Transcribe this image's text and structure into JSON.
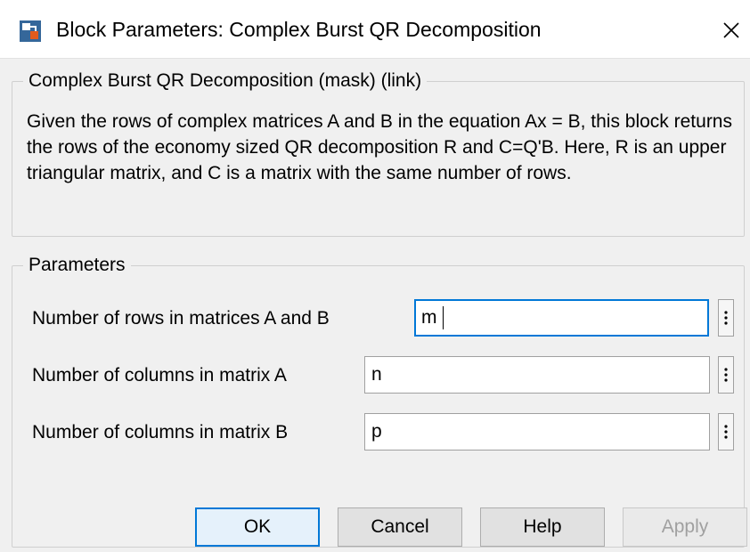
{
  "window": {
    "title": "Block Parameters: Complex Burst QR Decomposition",
    "close_icon": "close-icon",
    "app_icon": "simulink-block-icon"
  },
  "description_group": {
    "legend": "Complex Burst QR Decomposition (mask) (link)",
    "text": "Given the rows of complex matrices A and B in the equation Ax = B, this block returns the rows of the economy sized QR decomposition R and C=Q'B. Here, R is an upper triangular matrix, and C is a matrix with the same number of rows."
  },
  "parameters_group": {
    "legend": "Parameters",
    "fields": [
      {
        "label": "Number of rows in matrices A and B",
        "value": "m"
      },
      {
        "label": "Number of columns in matrix A",
        "value": "n"
      },
      {
        "label": "Number of columns in matrix B",
        "value": "p"
      }
    ],
    "field_menu_icon": "vertical-ellipsis-icon"
  },
  "buttons": {
    "ok": "OK",
    "cancel": "Cancel",
    "help": "Help",
    "apply": "Apply"
  },
  "colors": {
    "accent": "#0078d7",
    "dialog_background": "#f0f0f0",
    "disabled_text": "#a0a0a0"
  }
}
